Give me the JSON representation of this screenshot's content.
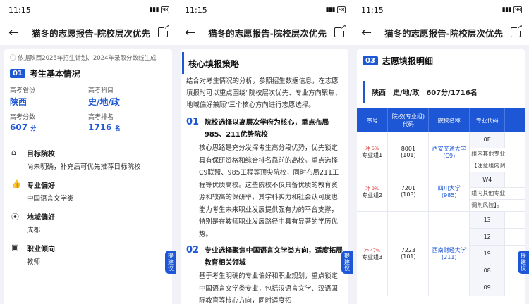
{
  "status": {
    "time": "11:15",
    "time_icon": "N",
    "battery": "98"
  },
  "nav": {
    "title": "猫冬的志愿报告-院校层次优先",
    "back_icon": "arrow-left",
    "share_icon": "share"
  },
  "float_button": {
    "label": "提建议"
  },
  "screen1": {
    "source": "依据陕西2025年招生计划、2024年录取分数线生成",
    "section_num": "01",
    "section_title": "考生基本情况",
    "fields": [
      {
        "label": "高考省份",
        "value": "陕西",
        "unit": ""
      },
      {
        "label": "高考科目",
        "value": "史/地/政",
        "unit": ""
      },
      {
        "label": "高考分数",
        "value": "607",
        "unit": "分"
      },
      {
        "label": "高考排名",
        "value": "1716",
        "unit": "名"
      }
    ],
    "items": [
      {
        "icon": "bank-icon",
        "title": "目标院校",
        "text": "尚未明确，补充后可优先推荐目标院校"
      },
      {
        "icon": "thumb-up-icon",
        "title": "专业偏好",
        "text": "中国语言文学类"
      },
      {
        "icon": "location-icon",
        "title": "地域偏好",
        "text": "成都"
      },
      {
        "icon": "briefcase-icon",
        "title": "职业倾向",
        "text": "教师"
      }
    ]
  },
  "screen2": {
    "section_title": "核心填报策略",
    "intro": "结合对考生情况的分析，参照招生数据信息，在志愿填报时可以重点围绕\"院校层次优先、专业方向聚焦、地域偏好兼顾\"三个核心方向进行志愿选择。",
    "points": [
      {
        "num": "01",
        "heading": "院校选择以高层次学府为核心，重点布局985、211优势院校",
        "body": "核心思路是充分发挥考生高分段优势，优先锁定具有保研资格和综合排名靠前的高校。重点选择C9联盟、985工程等顶尖院校，同时布局211工程等优质高校。这些院校不仅具备优质的教育资源和较高的保研率，其学科实力和社会认可度也能为考生未来职业发展提供强有力的平台支撑，特别是在教师职业发展路径中具有显著的学历优势。"
      },
      {
        "num": "02",
        "heading": "专业选择聚焦中国语言文学类方向，适度拓展教育相关领域",
        "body": "基于考生明确的专业偏好和职业规划，重点锁定中国语言文学类专业，包括汉语言文学、汉语国际教育等核心方向，同时适度拓"
      }
    ]
  },
  "screen3": {
    "section_num": "03",
    "section_title": "志愿填报明细",
    "filter": {
      "province": "陕西",
      "subjects": "史/地/政",
      "score": "607分/1716名"
    },
    "columns": [
      "序号",
      "院校(专业组)代码",
      "院校名称",
      "专业代码",
      "专业"
    ],
    "rows": [
      {
        "tag": "冲 5%",
        "group": "专业组1",
        "code": "8001",
        "sub": "(101)",
        "school": "西安交通大学",
        "school_sub": "(C9)",
        "majors": [
          "0E",
          "组内其他专业",
          "【注意组内调"
        ]
      },
      {
        "tag": "冲 9%",
        "group": "专业组2",
        "code": "7201",
        "sub": "(103)",
        "school": "四川大学",
        "school_sub": "(985)",
        "majors": [
          "W4",
          "组内其他专业",
          "调剂风险】。"
        ]
      },
      {
        "tag": "冲 47%",
        "group": "专业组3",
        "code": "7223",
        "sub": "(101)",
        "school": "西南财经大学",
        "school_sub": "(211)",
        "majors": [
          "13",
          "12",
          "19",
          "08",
          "09"
        ]
      }
    ]
  }
}
